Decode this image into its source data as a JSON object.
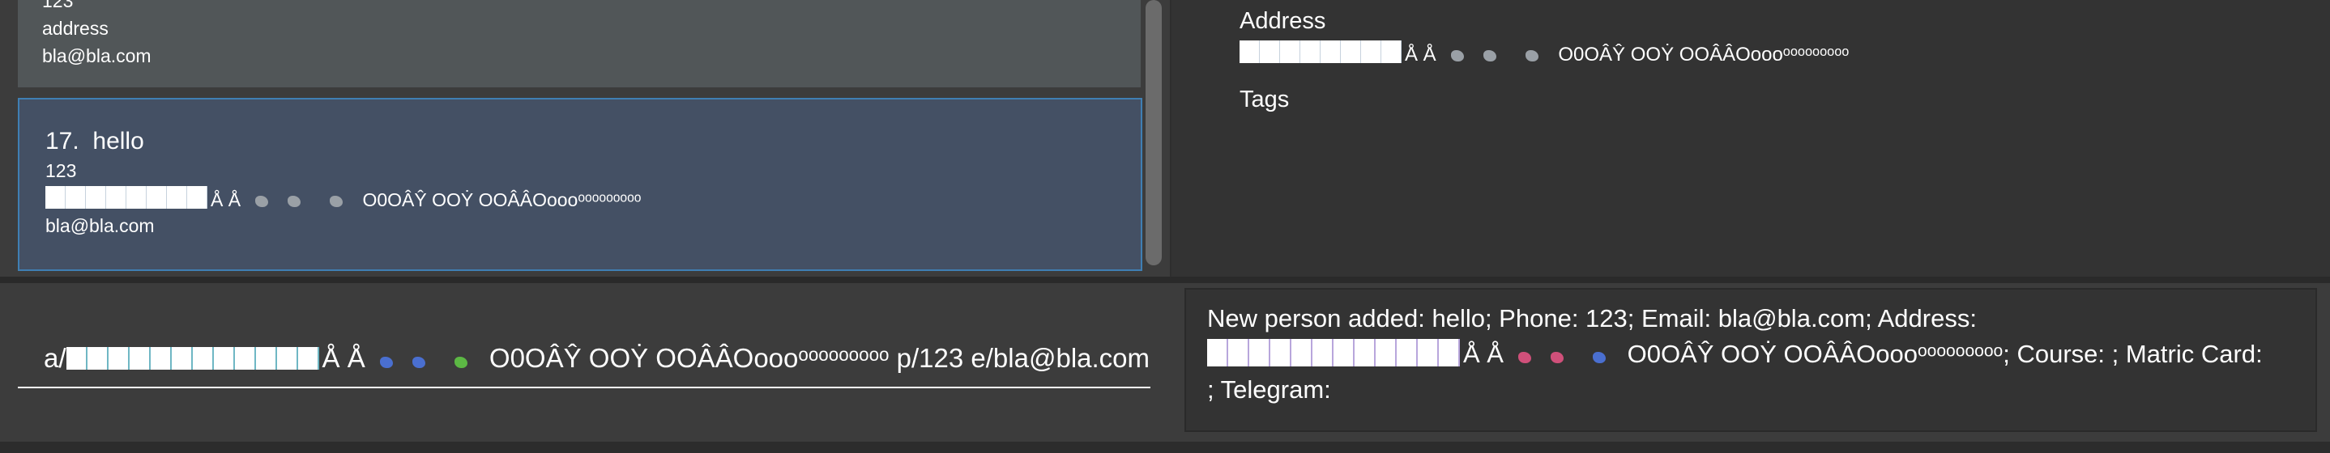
{
  "person_list": {
    "previous_card": {
      "phone": "123",
      "address": "address",
      "email": "bla@bla.com"
    },
    "selected_card": {
      "index": "17.",
      "name": "hello",
      "phone": "123",
      "address_text": "Å Å",
      "address_suffix": "O0OÂŶ OOẎ OOÂÂOoooᵒᵒᵒᵒᵒᵒᵒᵒᵒ",
      "email": "bla@bla.com"
    }
  },
  "detail": {
    "address_label": "Address",
    "address_text": "Å Å",
    "address_suffix": "O0OÂŶ OOẎ OOÂÂOoooᵒᵒᵒᵒᵒᵒᵒᵒᵒ",
    "tags_label": "Tags"
  },
  "command_box": {
    "prefix": "a/",
    "address_text": "Å Å",
    "address_suffix": "O0OÂŶ OOẎ OOÂÂOoooᵒᵒᵒᵒᵒᵒᵒᵒᵒ p/123 e/bla@bla.com"
  },
  "result_display": {
    "line1": "New person added: hello; Phone: 123; Email: bla@bla.com; Address:",
    "line2_text": "Å Å",
    "line2_suffix": "O0OÂŶ OOẎ OOÂÂOoooᵒᵒᵒᵒᵒᵒᵒᵒᵒ; Course: ; Matric Card:",
    "line3": "; Telegram:"
  },
  "icons": {
    "glyph_blocks": "white-box-glyphs",
    "swirl_gray": "gray-swirl-glyph",
    "swirl_blue": "blue-swirl-glyph",
    "swirl_green": "green-swirl-glyph",
    "swirl_pink": "pink-swirl-glyph"
  },
  "colors": {
    "selected_card_bg": "#445064",
    "selected_card_border": "#3f7fb3",
    "panel_bg": "#3c3c3c",
    "detail_bg": "#333333"
  }
}
